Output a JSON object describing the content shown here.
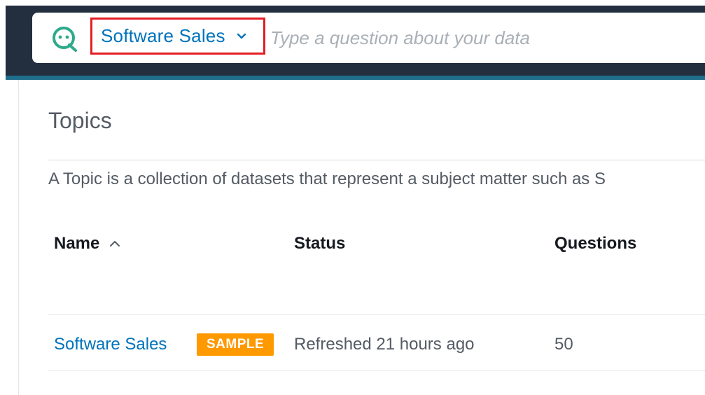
{
  "search_bar": {
    "logo_icon": "quicksight-q-icon",
    "selected_topic": "Software Sales",
    "placeholder": "Type a question about your data"
  },
  "colors": {
    "topbar": "#232f3e",
    "link": "#0073bb",
    "highlight_box": "#e31e24",
    "sample_badge": "#ff9900",
    "q_logo": "#2eaa8c"
  },
  "page": {
    "title": "Topics",
    "description": "A Topic is a collection of datasets that represent a subject matter such as S"
  },
  "table": {
    "columns": [
      {
        "label": "Name",
        "sort": "ascending"
      },
      {
        "label": "Status"
      },
      {
        "label": "Questions"
      }
    ],
    "rows": [
      {
        "name": "Software Sales",
        "badge": "SAMPLE",
        "status": "Refreshed 21 hours ago",
        "questions": "50"
      }
    ]
  }
}
